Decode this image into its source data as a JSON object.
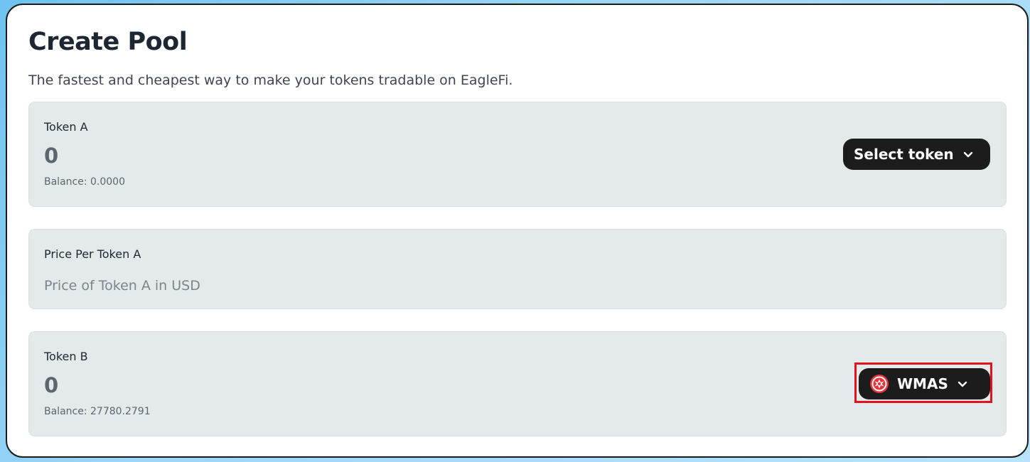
{
  "page": {
    "title": "Create Pool",
    "subtitle": "The fastest and cheapest way to make your tokens tradable on EagleFi."
  },
  "token_a": {
    "label": "Token A",
    "amount": "0",
    "balance": "Balance: 0.0000",
    "button_label": "Select token",
    "button_icon": "chevron-down-icon"
  },
  "price": {
    "label": "Price Per Token A",
    "placeholder": "Price of Token A in USD",
    "value": ""
  },
  "token_b": {
    "label": "Token B",
    "amount": "0",
    "balance": "Balance: 27780.2791",
    "button_label": "WMAS",
    "button_icon": "wmas-token-icon"
  },
  "colors": {
    "button_bg": "#1c1c1c",
    "panel_bg": "#e4eaea",
    "highlight": "#e0141e",
    "wmas_logo": "#e8353b"
  }
}
